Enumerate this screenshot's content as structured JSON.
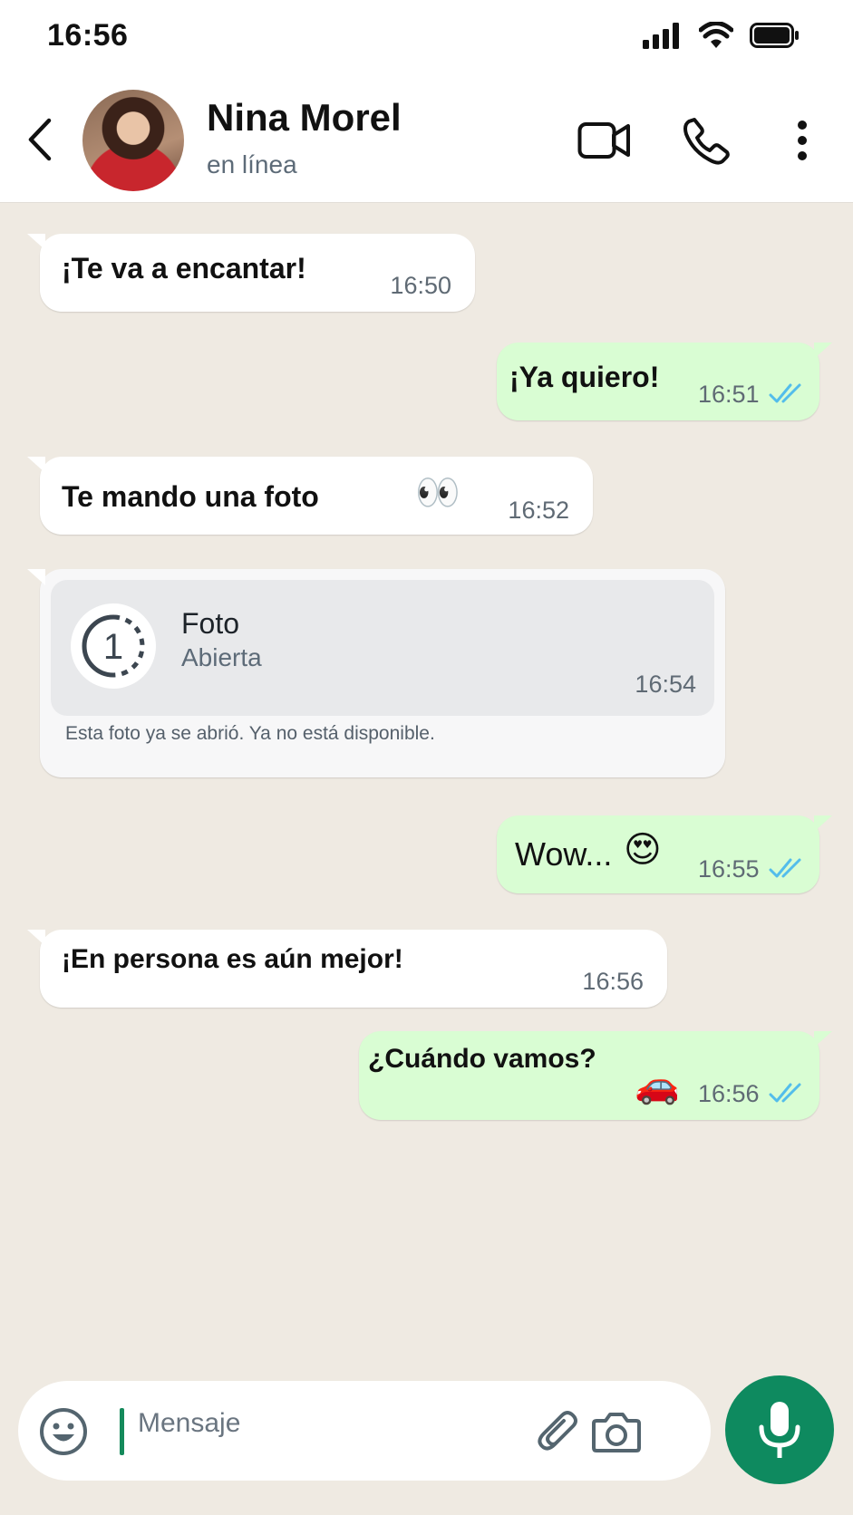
{
  "status_bar": {
    "time": "16:56"
  },
  "header": {
    "contact_name": "Nina Morel",
    "contact_status": "en línea",
    "icons": [
      "back-arrow-icon",
      "video-call-icon",
      "voice-call-icon",
      "more-options-icon"
    ]
  },
  "messages": [
    {
      "direction": "in",
      "text": "¡Te va a encantar!",
      "time": "16:50"
    },
    {
      "direction": "out",
      "text": "¡Ya quiero!",
      "time": "16:51",
      "read": true
    },
    {
      "direction": "in",
      "text": "Te mando una foto",
      "emoji": "👀",
      "time": "16:52"
    },
    {
      "direction": "in",
      "type": "view-once-photo",
      "title": "Foto",
      "subtitle": "Abierta",
      "time": "16:54",
      "note": "Esta foto ya se abrió. Ya no está disponible."
    },
    {
      "direction": "out",
      "text": "Wow...",
      "emoji": "😍",
      "time": "16:55",
      "read": true
    },
    {
      "direction": "in",
      "text": "¡En persona es aún mejor!",
      "time": "16:56"
    },
    {
      "direction": "out",
      "text": "¿Cuándo vamos?",
      "emoji": "🚗",
      "time": "16:56",
      "read": true
    }
  ],
  "composer": {
    "placeholder": "Mensaje",
    "icons": [
      "emoji-icon",
      "attach-icon",
      "camera-icon",
      "microphone-icon"
    ]
  },
  "colors": {
    "chat_background": "#efeae2",
    "incoming_bubble": "#ffffff",
    "outgoing_bubble": "#d9fdd3",
    "read_ticks": "#53bdeb",
    "accent": "#0e8a5f"
  }
}
